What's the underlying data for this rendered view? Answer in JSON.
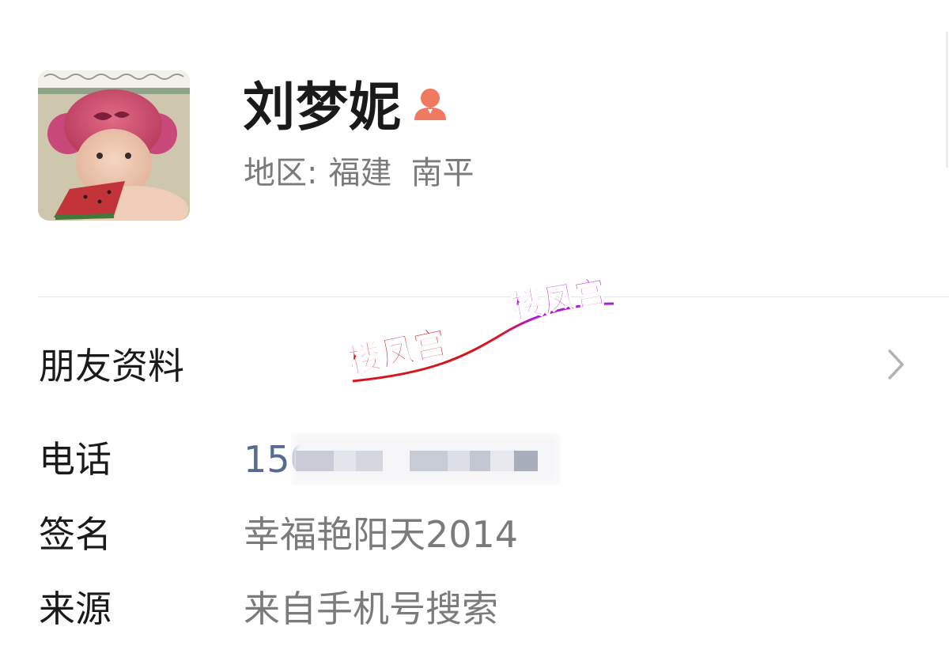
{
  "profile": {
    "name": "刘梦妮",
    "gender_icon": "female-icon",
    "region_label": "地区:",
    "region_province": "福建",
    "region_city": "南平"
  },
  "friend_profile": {
    "label": "朋友资料"
  },
  "info": {
    "phone_label": "电话",
    "phone_value": "150",
    "signature_label": "签名",
    "signature_value": "幸福艳阳天2014",
    "source_label": "来源",
    "source_value": "来自手机号搜索"
  },
  "watermark": {
    "text_1": "楼凤宫",
    "text_2": "楼凤宫"
  },
  "colors": {
    "accent_female": "#f07a5f",
    "phone_link": "#566a93",
    "watermark_red": "#d8151c",
    "watermark_purple": "#b01bd8"
  }
}
